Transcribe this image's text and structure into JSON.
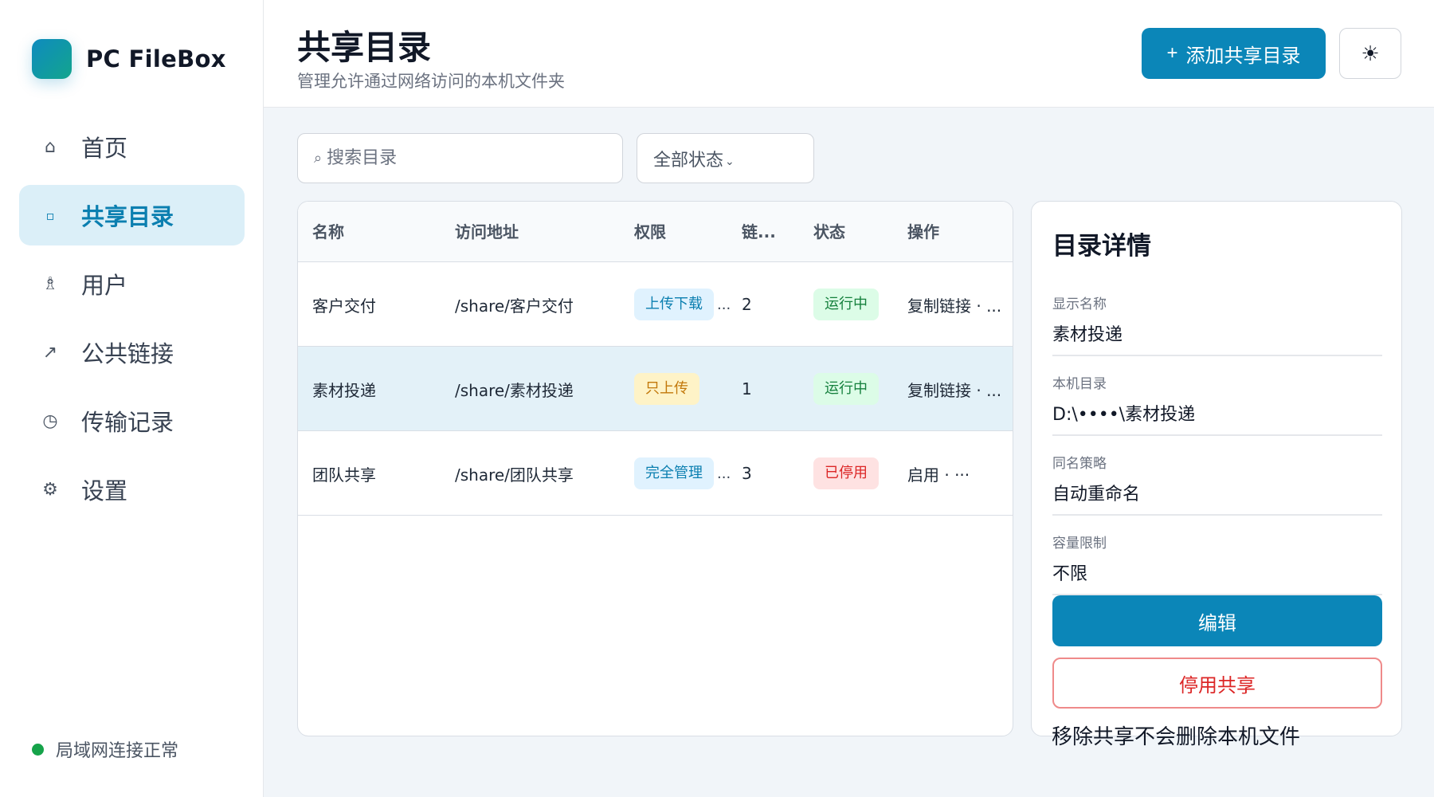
{
  "app": {
    "name": "PC FileBox"
  },
  "sidebar": {
    "items": [
      {
        "label": "首页",
        "icon": "home-icon",
        "glyph": "⌂"
      },
      {
        "label": "共享目录",
        "icon": "folder-icon",
        "glyph": "▫"
      },
      {
        "label": "用户",
        "icon": "user-icon",
        "glyph": "♗"
      },
      {
        "label": "公共链接",
        "icon": "link-icon",
        "glyph": "↗"
      },
      {
        "label": "传输记录",
        "icon": "clock-icon",
        "glyph": "◷"
      },
      {
        "label": "设置",
        "icon": "gear-icon",
        "glyph": "⚙"
      }
    ],
    "active_index": 1,
    "network_status": "局域网连接正常"
  },
  "header": {
    "title": "共享目录",
    "subtitle": "管理允许通过网络访问的本机文件夹",
    "add_button": "添加共享目录",
    "add_button_icon": "+",
    "theme_icon": "☀"
  },
  "filters": {
    "search_placeholder": "搜索目录",
    "search_icon": "⌕",
    "status_value": "全部状态",
    "status_chevron": "⌄"
  },
  "table": {
    "columns": [
      "名称",
      "访问地址",
      "权限",
      "链...",
      "状态",
      "操作"
    ],
    "rows": [
      {
        "name": "客户交付",
        "url": "/share/客户交付",
        "permission": "上传下载",
        "perm_truncated": "...",
        "links": "2",
        "status": "运行中",
        "ops": "复制链接 · ..."
      },
      {
        "name": "素材投递",
        "url": "/share/素材投递",
        "permission": "只上传",
        "perm_truncated": "",
        "links": "1",
        "status": "运行中",
        "ops": "复制链接 · ..."
      },
      {
        "name": "团队共享",
        "url": "/share/团队共享",
        "permission": "完全管理",
        "perm_truncated": "...",
        "links": "3",
        "status": "已停用",
        "ops": "启用 · ···"
      }
    ]
  },
  "detail": {
    "title": "目录详情",
    "fields": [
      {
        "label": "显示名称",
        "value": "素材投递"
      },
      {
        "label": "本机目录",
        "value": "D:\\••••\\素材投递"
      },
      {
        "label": "同名策略",
        "value": "自动重命名"
      },
      {
        "label": "容量限制",
        "value": "不限"
      }
    ],
    "edit_button": "编辑",
    "stop_button": "停用共享",
    "note": "移除共享不会删除本机文件"
  },
  "colors": {
    "accent": "#0b86b8",
    "accent_light": "#dbeff8",
    "success": "#16a34a",
    "danger": "#dc2626",
    "warning": "#c2780a"
  }
}
